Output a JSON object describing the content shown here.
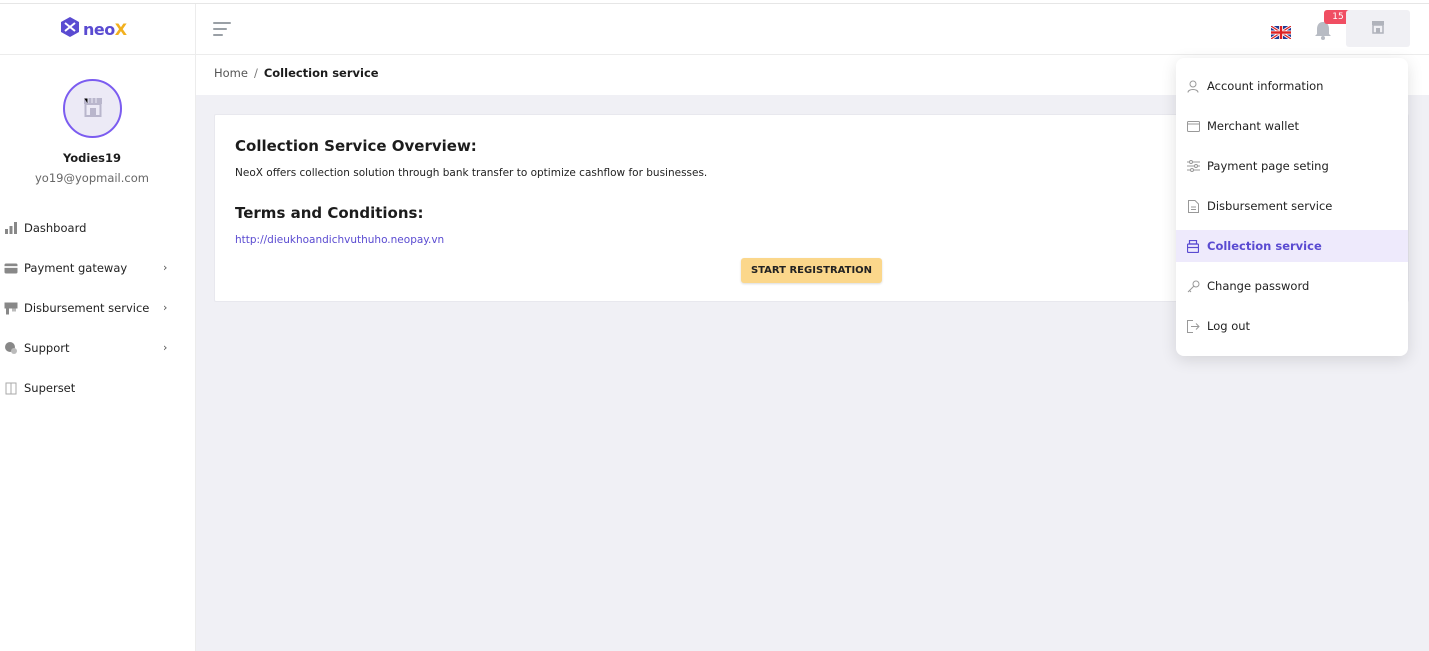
{
  "brand": {
    "name_main": "neo",
    "name_accent": "X"
  },
  "header": {
    "language": "English (UK flag)",
    "notification_count": "15"
  },
  "profile": {
    "name": "Yodies19",
    "email": "yo19@yopmail.com"
  },
  "sidebar": {
    "items": [
      {
        "label": "Dashboard",
        "icon": "bar-chart-icon",
        "has_submenu": false
      },
      {
        "label": "Payment gateway",
        "icon": "card-icon",
        "has_submenu": true
      },
      {
        "label": "Disbursement service",
        "icon": "pos-terminal-icon",
        "has_submenu": true
      },
      {
        "label": "Support",
        "icon": "support-icon",
        "has_submenu": true
      },
      {
        "label": "Superset",
        "icon": "book-icon",
        "has_submenu": false
      }
    ]
  },
  "breadcrumb": {
    "home": "Home",
    "separator": "/",
    "current": "Collection service"
  },
  "card": {
    "overview_title": "Collection Service Overview:",
    "overview_text": "NeoX offers collection solution through bank transfer to optimize cashflow for businesses.",
    "terms_title": "Terms and Conditions:",
    "terms_link": "http://dieukhoandichvuthuho.neopay.vn",
    "start_button": "START REGISTRATION"
  },
  "dropdown": {
    "items": [
      {
        "label": "Account information",
        "icon": "user-icon",
        "active": false
      },
      {
        "label": "Merchant wallet",
        "icon": "wallet-icon",
        "active": false
      },
      {
        "label": "Payment page seting",
        "icon": "sliders-icon",
        "active": false
      },
      {
        "label": "Disbursement service",
        "icon": "document-icon",
        "active": false
      },
      {
        "label": "Collection service",
        "icon": "collection-icon",
        "active": true
      },
      {
        "label": "Change password",
        "icon": "key-icon",
        "active": false
      },
      {
        "label": "Log out",
        "icon": "logout-icon",
        "active": false
      }
    ]
  },
  "colors": {
    "brand_purple": "#5a4bd1",
    "brand_yellow": "#f2b01e",
    "badge_red": "#f04e62",
    "button_yellow": "#fbd78b",
    "active_bg": "#eeeafc",
    "main_bg": "#f0f0f5"
  }
}
